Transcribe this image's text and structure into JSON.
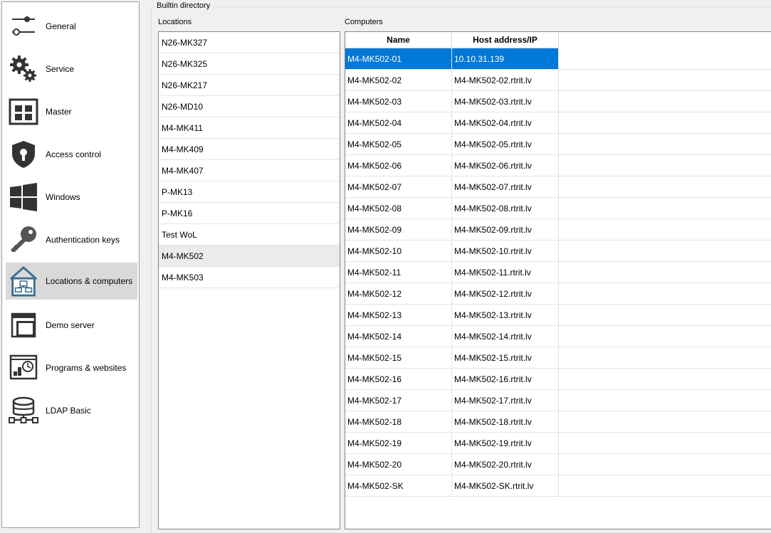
{
  "nav": {
    "items": [
      {
        "label": "General",
        "icon": "sliders-icon"
      },
      {
        "label": "Service",
        "icon": "gears-icon"
      },
      {
        "label": "Master",
        "icon": "master-grid-icon"
      },
      {
        "label": "Access control",
        "icon": "shield-keyhole-icon"
      },
      {
        "label": "Windows",
        "icon": "windows-logo-icon"
      },
      {
        "label": "Authentication keys",
        "icon": "key-icon"
      },
      {
        "label": "Locations & computers",
        "icon": "house-network-icon",
        "selected": true
      },
      {
        "label": "Demo server",
        "icon": "demo-window-icon"
      },
      {
        "label": "Programs & websites",
        "icon": "programs-clock-icon"
      },
      {
        "label": "LDAP Basic",
        "icon": "database-network-icon"
      }
    ]
  },
  "group": {
    "title": "Builtin directory"
  },
  "locations": {
    "label": "Locations",
    "items": [
      "N26-MK327",
      "N26-MK325",
      "N26-MK217",
      "N26-MD10",
      "M4-MK411",
      "M4-MK409",
      "M4-MK407",
      "P-MK13",
      "P-MK16",
      "Test WoL",
      "M4-MK502",
      "M4-MK503"
    ],
    "selected_index": 10
  },
  "computers": {
    "label": "Computers",
    "columns": [
      "Name",
      "Host address/IP"
    ],
    "selected_index": 0,
    "rows": [
      [
        "M4-MK502-01",
        "10.10.31.139"
      ],
      [
        "M4-MK502-02",
        "M4-MK502-02.rtrit.lv"
      ],
      [
        "M4-MK502-03",
        "M4-MK502-03.rtrit.lv"
      ],
      [
        "M4-MK502-04",
        "M4-MK502-04.rtrit.lv"
      ],
      [
        "M4-MK502-05",
        "M4-MK502-05.rtrit.lv"
      ],
      [
        "M4-MK502-06",
        "M4-MK502-06.rtrit.lv"
      ],
      [
        "M4-MK502-07",
        "M4-MK502-07.rtrit.lv"
      ],
      [
        "M4-MK502-08",
        "M4-MK502-08.rtrit.lv"
      ],
      [
        "M4-MK502-09",
        "M4-MK502-09.rtrit.lv"
      ],
      [
        "M4-MK502-10",
        "M4-MK502-10.rtrit.lv"
      ],
      [
        "M4-MK502-11",
        "M4-MK502-11.rtrit.lv"
      ],
      [
        "M4-MK502-12",
        "M4-MK502-12.rtrit.lv"
      ],
      [
        "M4-MK502-13",
        "M4-MK502-13.rtrit.lv"
      ],
      [
        "M4-MK502-14",
        "M4-MK502-14.rtrit.lv"
      ],
      [
        "M4-MK502-15",
        "M4-MK502-15.rtrit.lv"
      ],
      [
        "M4-MK502-16",
        "M4-MK502-16.rtrit.lv"
      ],
      [
        "M4-MK502-17",
        "M4-MK502-17.rtrit.lv"
      ],
      [
        "M4-MK502-18",
        "M4-MK502-18.rtrit.lv"
      ],
      [
        "M4-MK502-19",
        "M4-MK502-19.rtrit.lv"
      ],
      [
        "M4-MK502-20",
        "M4-MK502-20.rtrit.lv"
      ],
      [
        "M4-MK502-SK",
        "M4-MK502-SK.rtrit.lv"
      ]
    ]
  },
  "colors": {
    "selection": "#0078d7",
    "nav_selected": "#d9d9d9",
    "icon": "#333333",
    "accent_blue": "#3c6e91"
  }
}
